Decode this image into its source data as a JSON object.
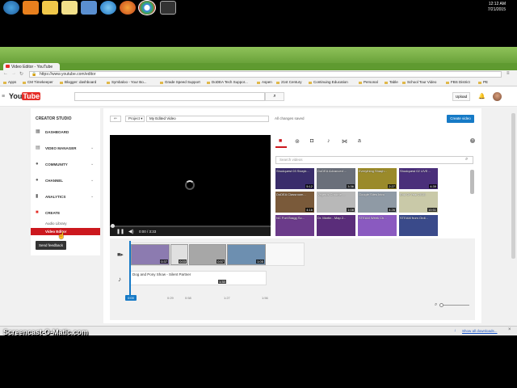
{
  "taskbar": {
    "clock_time": "12:12 AM",
    "clock_date": "7/21/2015"
  },
  "browser": {
    "tab_title": "Video Editor - YouTube",
    "url": "https://www.youtube.com/editor",
    "bookmarks": [
      "Apps",
      "CM Timekeeper",
      "Blogger: dashboard",
      "Symbaloo - Your Bo...",
      "Grade Speed Support",
      "DoDEA Tech Suppor...",
      "Aspen",
      "21st Century",
      "Continuing Education",
      "Personal",
      "Table",
      "School Tour Video",
      "FBS District",
      "PE"
    ]
  },
  "header": {
    "upload_label": "Upload"
  },
  "sidebar": {
    "title": "CREATOR STUDIO",
    "items": [
      {
        "label": "DASHBOARD",
        "icon": "dashboard-icon"
      },
      {
        "label": "VIDEO MANAGER",
        "icon": "video-manager-icon"
      },
      {
        "label": "COMMUNITY",
        "icon": "community-icon"
      },
      {
        "label": "CHANNEL",
        "icon": "channel-icon"
      },
      {
        "label": "ANALYTICS",
        "icon": "analytics-icon"
      },
      {
        "label": "CREATE",
        "icon": "create-icon"
      }
    ],
    "sub_audio": "Audio Library",
    "sub_editor": "Video Editor",
    "feedback": "Send feedback"
  },
  "editor": {
    "project_label": "Project",
    "title_value": "My Edited Video",
    "saved_status": "All changes saved",
    "create_button": "Create video",
    "player_time": "0:00 / 3:33",
    "search_placeholder": "Search videos",
    "thumbs": [
      {
        "title": "Shodquest 03 Storyb...",
        "dur": "5:12",
        "color": "#3a2d6b"
      },
      {
        "title": "DoDEA Advanced ...",
        "dur": "3:36",
        "color": "#6a6f7a"
      },
      {
        "title": "Everything Shaqh...",
        "dur": "2:27",
        "color": "#9a8a2a"
      },
      {
        "title": "Shodquest 02 LIVE...",
        "dur": "4:39",
        "color": "#4a2f7a"
      },
      {
        "title": "DoDEA Classroom...",
        "dur": "4:16",
        "color": "#7a5a3a"
      },
      {
        "title": "Vegetus Chrome ...",
        "dur": "1:08",
        "color": "#b8b8b8"
      },
      {
        "title": "Google Sites Intro",
        "dur": "4:26",
        "color": "#8f9aa5"
      },
      {
        "title": "End Of Year 2015",
        "dur": "10:51",
        "color": "#c9c9a8"
      },
      {
        "title": "NC Fort Bragg Sc...",
        "dur": "",
        "color": "#6b3b8a"
      },
      {
        "title": "Dr. Martin - Map 2...",
        "dur": "",
        "color": "#5a2d7a"
      },
      {
        "title": "STEAM Week Ch...",
        "dur": "",
        "color": "#8a5ac0"
      },
      {
        "title": "STEAM from Ordi...",
        "dur": "",
        "color": "#3a4a8a"
      }
    ],
    "clips": [
      {
        "dur": "0:37",
        "color": "#8c7bb0"
      },
      {
        "dur": "0:03",
        "color": "#e0e0e0"
      },
      {
        "dur": "0:57",
        "color": "#a7a7a7"
      },
      {
        "dur": "1:05",
        "color": "#6d8fb0"
      }
    ],
    "audio_track": "Dog and Pony Show - Silent Partner",
    "audio_dur": "1:33",
    "playhead_time": "0:00",
    "ticks": [
      "0:29",
      "0:58",
      "1:27",
      "1:56"
    ]
  },
  "downloads": {
    "show_all": "Show all downloads..."
  },
  "watermark": "Screencast-O-Matic.com"
}
